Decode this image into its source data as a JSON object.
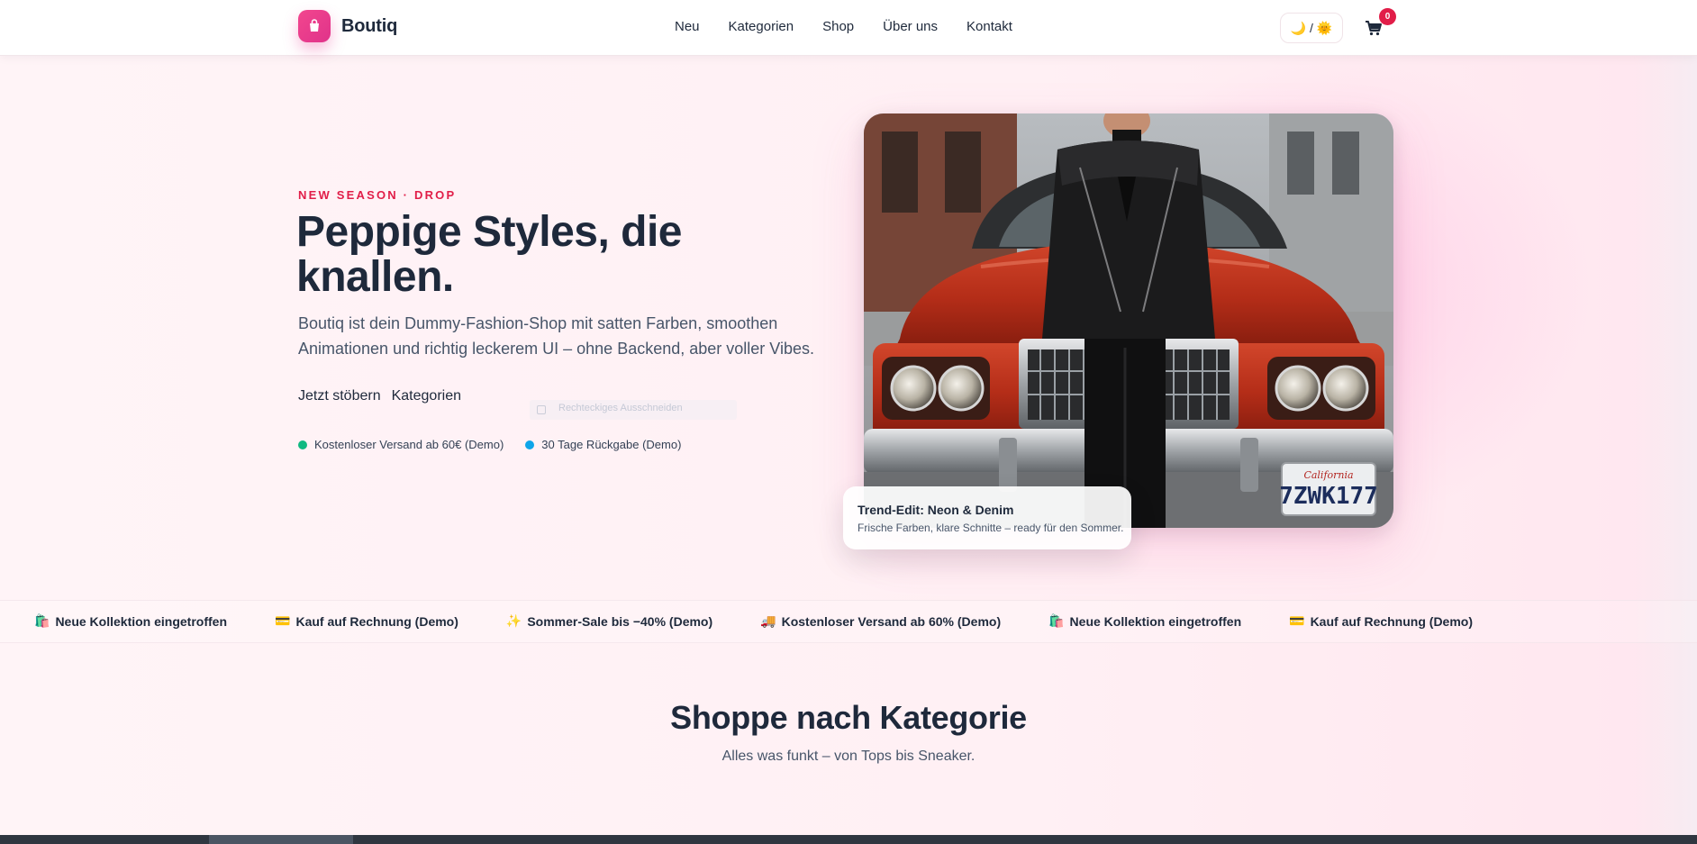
{
  "header": {
    "brand": "Boutiq",
    "nav": [
      "Neu",
      "Kategorien",
      "Shop",
      "Über uns",
      "Kontakt"
    ],
    "theme_toggle": "🌙 / 🌞",
    "cart_count": "0"
  },
  "hero": {
    "eyebrow": "NEW SEASON · DROP",
    "title": "Peppige Styles, die knallen.",
    "text": "Boutiq ist dein Dummy-Fashion-Shop mit satten Farben, smoothen Animationen und richtig leckerem UI – ohne Backend, aber voller Vibes.",
    "cta_primary": "Jetzt stöbern",
    "cta_secondary": "Kategorien",
    "ghost_tooltip": "Rechteckiges Ausschneiden",
    "features": [
      {
        "label": "Kostenloser Versand ab 60€ (Demo)",
        "color": "#10b981"
      },
      {
        "label": "30 Tage Rückgabe (Demo)",
        "color": "#0ea5e9"
      }
    ],
    "plate": "7ZWK177",
    "plate_state": "California",
    "trend_title": "Trend-Edit: Neon & Denim",
    "trend_sub": "Frische Farben, klare Schnitte – ready für den Sommer."
  },
  "ticker": [
    {
      "icon": "🛍️",
      "label": "Neue Kollektion eingetroffen"
    },
    {
      "icon": "💳",
      "label": "Kauf auf Rechnung (Demo)"
    },
    {
      "icon": "✨",
      "label": "Sommer-Sale bis −40% (Demo)"
    },
    {
      "icon": "🚚",
      "label": "Kostenloser Versand ab 60% (Demo)"
    },
    {
      "icon": "🛍️",
      "label": "Neue Kollektion eingetroffen"
    },
    {
      "icon": "💳",
      "label": "Kauf auf Rechnung (Demo)"
    }
  ],
  "categories": {
    "title": "Shoppe nach Kategorie",
    "subtitle": "Alles was funkt – von Tops bis Sneaker."
  },
  "colors": {
    "accent": "#e11d48",
    "brand_pink": "#ec4899",
    "text_dark": "#1e293b",
    "car_red": "#c0311e"
  }
}
